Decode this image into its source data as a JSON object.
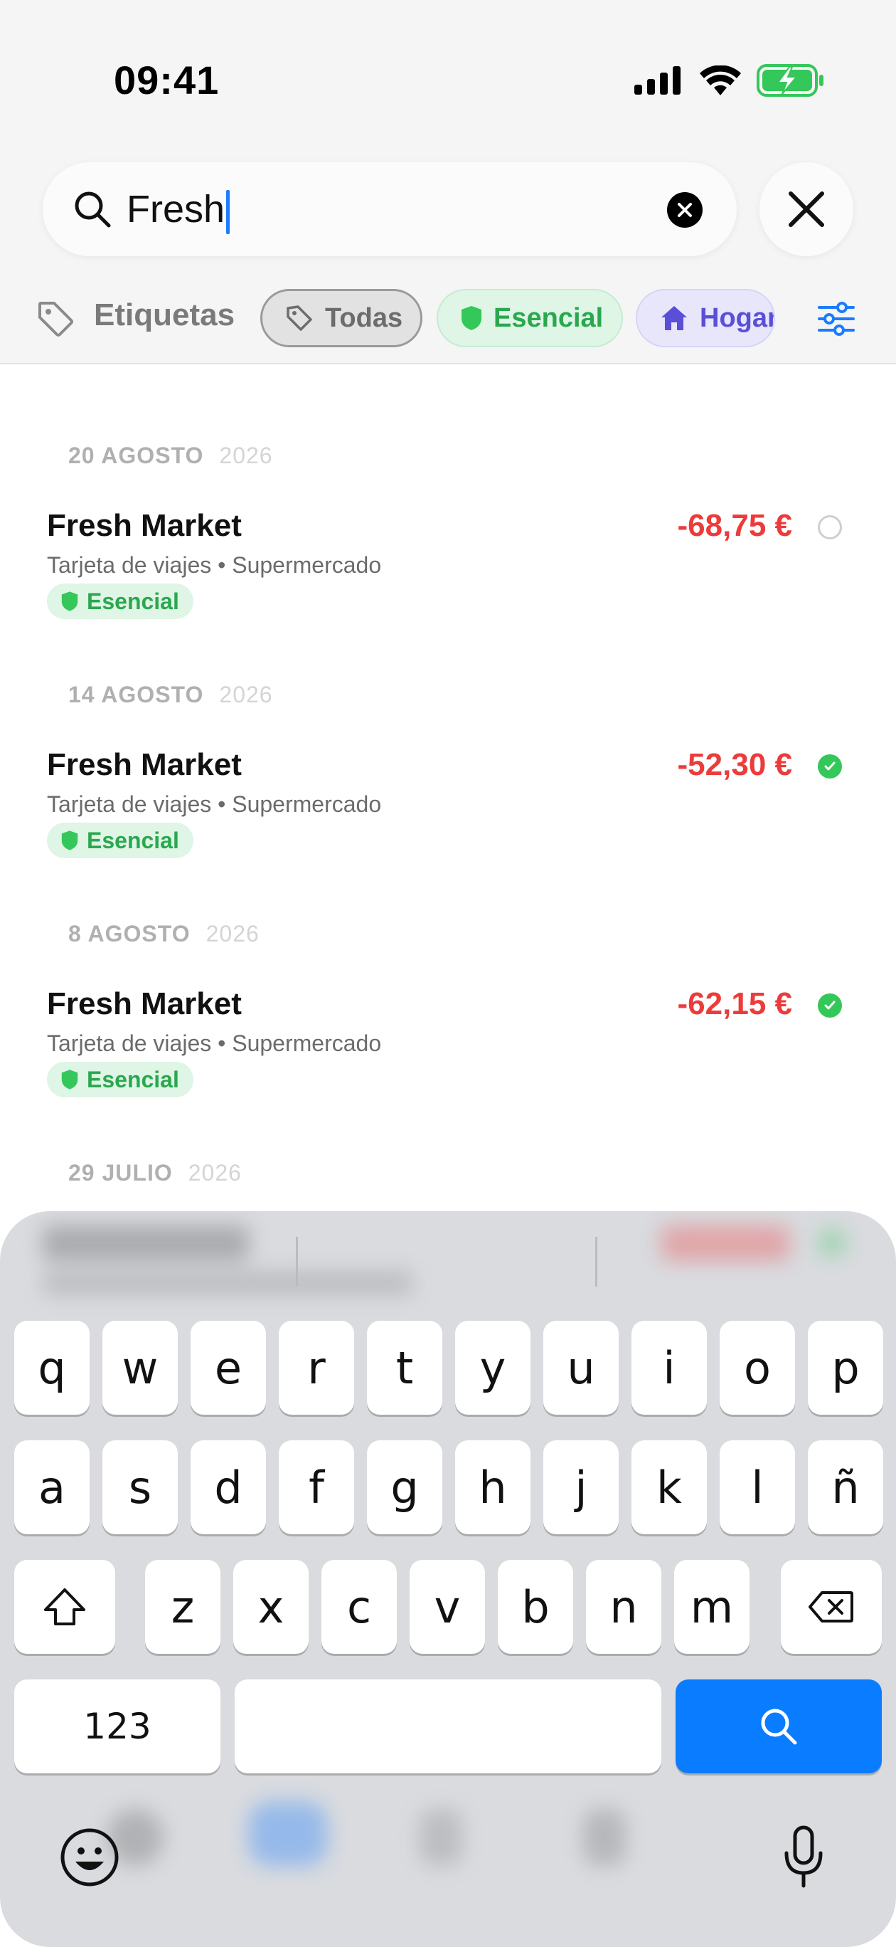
{
  "status_bar": {
    "time": "09:41"
  },
  "search": {
    "query": "Fresh"
  },
  "tags": {
    "label": "Etiquetas",
    "chips": [
      {
        "label": "Todas",
        "selected": true
      },
      {
        "label": "Esencial",
        "color": "#2aa84e"
      },
      {
        "label": "Hogar",
        "color": "#5a4fd6"
      }
    ]
  },
  "transactions": [
    {
      "date": "20 AGOSTO",
      "year": "2026",
      "title": "Fresh Market",
      "subtitle": "Tarjeta de viajes • Supermercado",
      "amount": "-68,75 €",
      "tag": "Esencial",
      "status": "pending"
    },
    {
      "date": "14 AGOSTO",
      "year": "2026",
      "title": "Fresh Market",
      "subtitle": "Tarjeta de viajes • Supermercado",
      "amount": "-52,30 €",
      "tag": "Esencial",
      "status": "done"
    },
    {
      "date": "8 AGOSTO",
      "year": "2026",
      "title": "Fresh Market",
      "subtitle": "Tarjeta de viajes • Supermercado",
      "amount": "-62,15 €",
      "tag": "Esencial",
      "status": "done"
    },
    {
      "date": "29 JULIO",
      "year": "2026"
    }
  ],
  "keyboard": {
    "row1": [
      "q",
      "w",
      "e",
      "r",
      "t",
      "y",
      "u",
      "i",
      "o",
      "p"
    ],
    "row2": [
      "a",
      "s",
      "d",
      "f",
      "g",
      "h",
      "j",
      "k",
      "l",
      "ñ"
    ],
    "row3": [
      "z",
      "x",
      "c",
      "v",
      "b",
      "n",
      "m"
    ],
    "numbers_key": "123"
  },
  "colors": {
    "accent": "#0a7cff",
    "expense": "#ec3b3b",
    "essential": "#34c759"
  }
}
